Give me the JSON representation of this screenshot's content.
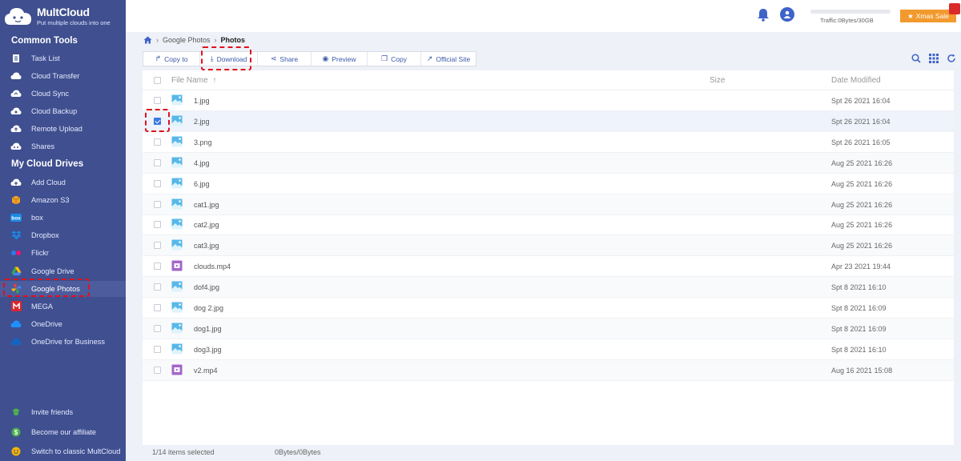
{
  "app": {
    "name": "MultCloud",
    "tagline": "Put multiple clouds into one"
  },
  "sidebar": {
    "common_tools_title": "Common Tools",
    "common_tools": [
      {
        "label": "Task List",
        "icon": "task-list-icon"
      },
      {
        "label": "Cloud Transfer",
        "icon": "cloud-transfer-icon"
      },
      {
        "label": "Cloud Sync",
        "icon": "cloud-sync-icon"
      },
      {
        "label": "Cloud Backup",
        "icon": "cloud-backup-icon"
      },
      {
        "label": "Remote Upload",
        "icon": "remote-upload-icon"
      },
      {
        "label": "Shares",
        "icon": "shares-icon"
      }
    ],
    "drives_title": "My Cloud Drives",
    "drives": [
      {
        "label": "Add Cloud",
        "icon": "add-cloud-icon"
      },
      {
        "label": "Amazon S3",
        "icon": "amazon-s3-icon"
      },
      {
        "label": "box",
        "icon": "box-icon"
      },
      {
        "label": "Dropbox",
        "icon": "dropbox-icon"
      },
      {
        "label": "Flickr",
        "icon": "flickr-icon"
      },
      {
        "label": "Google Drive",
        "icon": "google-drive-icon"
      },
      {
        "label": "Google Photos",
        "icon": "google-photos-icon",
        "active": true
      },
      {
        "label": "MEGA",
        "icon": "mega-icon"
      },
      {
        "label": "OneDrive",
        "icon": "onedrive-icon"
      },
      {
        "label": "OneDrive for Business",
        "icon": "onedrive-business-icon"
      }
    ],
    "footer": [
      {
        "label": "Invite friends",
        "icon": "invite-icon"
      },
      {
        "label": "Become our affiliate",
        "icon": "affiliate-icon"
      },
      {
        "label": "Switch to classic MultCloud",
        "icon": "switch-classic-icon"
      }
    ]
  },
  "topbar": {
    "traffic": "Traffic:0Bytes/30GB",
    "xmas_sale": "Xmas Sale"
  },
  "breadcrumb": {
    "parent": "Google Photos",
    "current": "Photos"
  },
  "toolbar": {
    "copy_to": "Copy to",
    "download": "Download",
    "share": "Share",
    "preview": "Preview",
    "copy": "Copy",
    "official_site": "Official Site"
  },
  "table": {
    "col_name": "File Name",
    "col_size": "Size",
    "col_date": "Date Modified",
    "rows": [
      {
        "name": "1.jpg",
        "date": "Spt 26 2021 16:04",
        "type": "image",
        "checked": false
      },
      {
        "name": "2.jpg",
        "date": "Spt 26 2021 16:04",
        "type": "image",
        "checked": true
      },
      {
        "name": "3.png",
        "date": "Spt 26 2021 16:05",
        "type": "image",
        "checked": false
      },
      {
        "name": "4.jpg",
        "date": "Aug 25 2021 16:26",
        "type": "image",
        "checked": false
      },
      {
        "name": "6.jpg",
        "date": "Aug 25 2021 16:26",
        "type": "image",
        "checked": false
      },
      {
        "name": "cat1.jpg",
        "date": "Aug 25 2021 16:26",
        "type": "image",
        "checked": false
      },
      {
        "name": "cat2.jpg",
        "date": "Aug 25 2021 16:26",
        "type": "image",
        "checked": false
      },
      {
        "name": "cat3.jpg",
        "date": "Aug 25 2021 16:26",
        "type": "image",
        "checked": false
      },
      {
        "name": "clouds.mp4",
        "date": "Apr 23 2021 19:44",
        "type": "video",
        "checked": false
      },
      {
        "name": "dof4.jpg",
        "date": "Spt 8 2021 16:10",
        "type": "image",
        "checked": false
      },
      {
        "name": "dog 2.jpg",
        "date": "Spt 8 2021 16:09",
        "type": "image",
        "checked": false
      },
      {
        "name": "dog1.jpg",
        "date": "Spt 8 2021 16:09",
        "type": "image",
        "checked": false
      },
      {
        "name": "dog3.jpg",
        "date": "Spt 8 2021 16:10",
        "type": "image",
        "checked": false
      },
      {
        "name": "v2.mp4",
        "date": "Aug 16 2021 15:08",
        "type": "video",
        "checked": false
      }
    ]
  },
  "status": {
    "selected": "1/14 items selected",
    "bytes": "0Bytes/0Bytes"
  },
  "colors": {
    "sidebar_bg": "#3f4f8f",
    "accent": "#3b7ae0",
    "highlight": "#e0111d",
    "xmas": "#f29a2e"
  }
}
